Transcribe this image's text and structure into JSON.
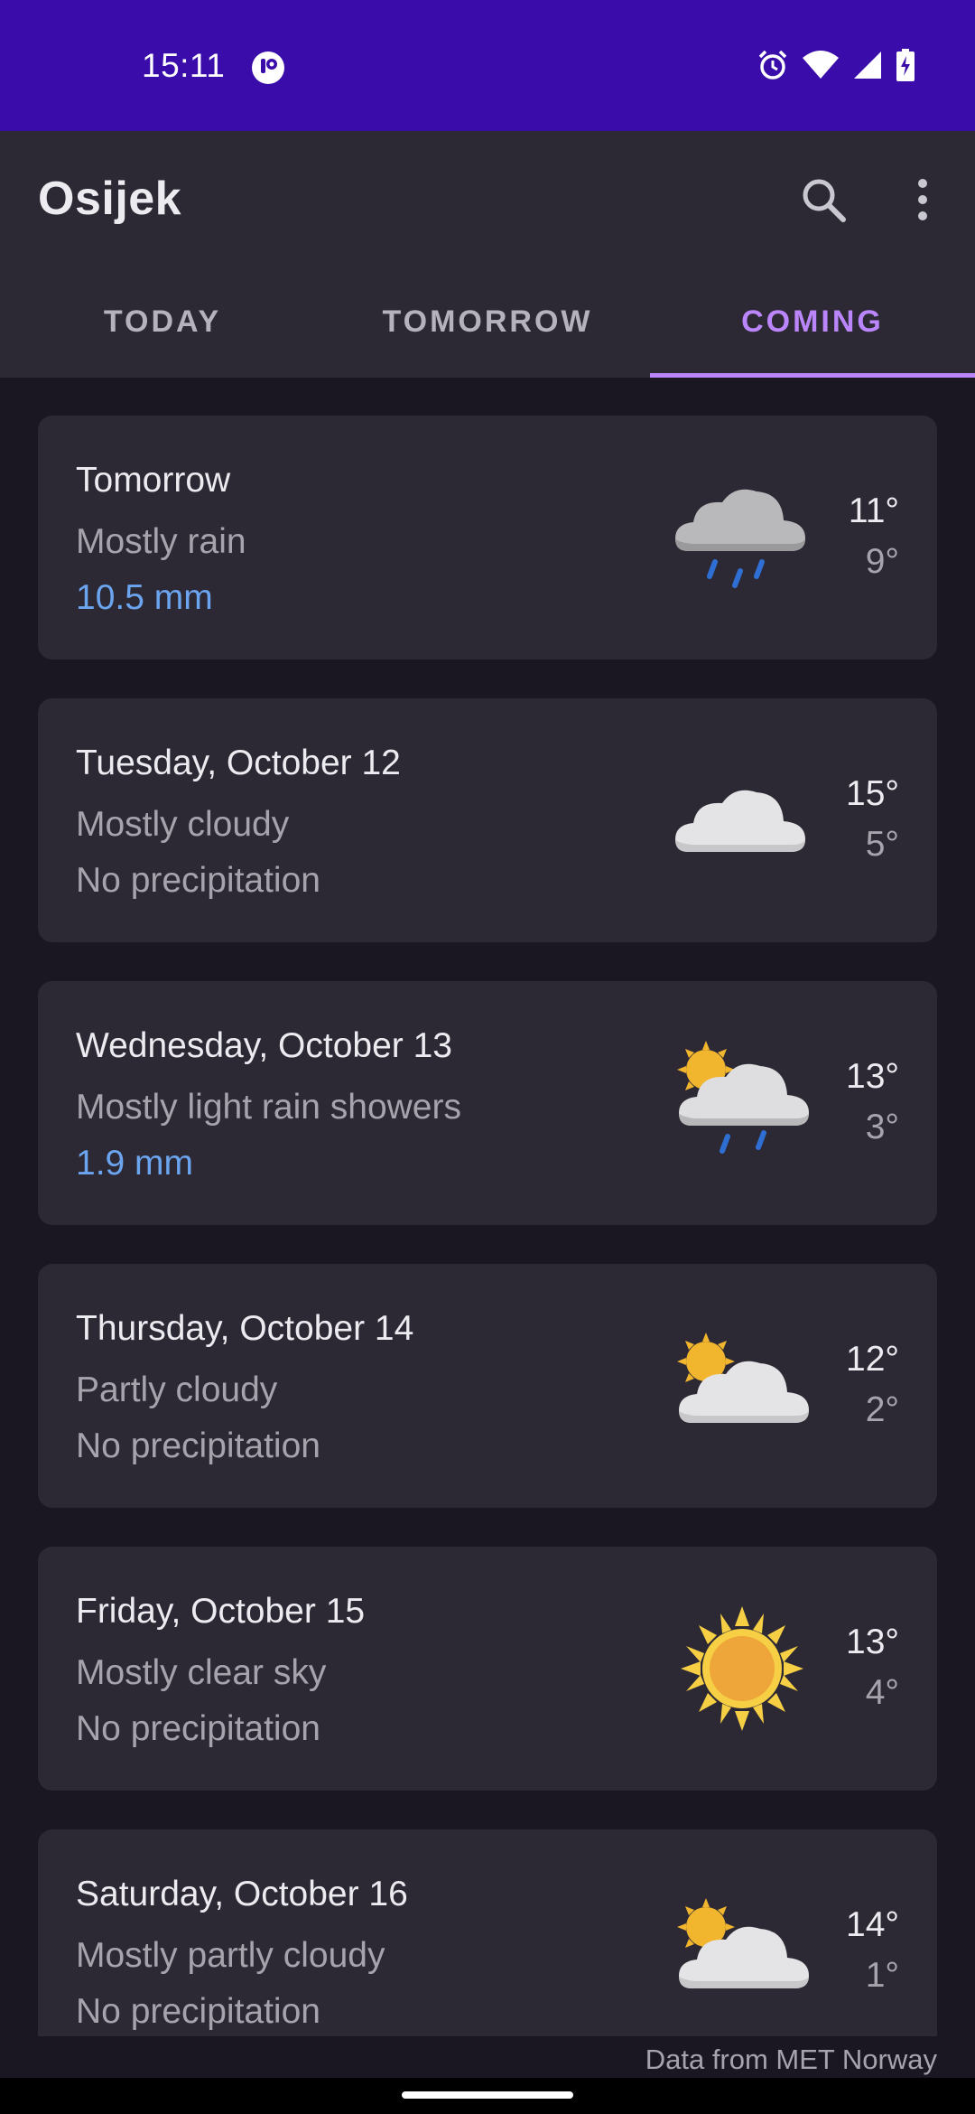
{
  "status_bar": {
    "time": "15:11",
    "icons": [
      "app-notification-icon",
      "alarm-icon",
      "wifi-icon",
      "signal-icon",
      "battery-charging-icon"
    ]
  },
  "app_bar": {
    "title": "Osijek",
    "actions": [
      "search-icon",
      "more-vert-icon"
    ]
  },
  "tabs": [
    {
      "label": "TODAY",
      "active": false
    },
    {
      "label": "TOMORROW",
      "active": false
    },
    {
      "label": "COMING",
      "active": true
    }
  ],
  "forecast": [
    {
      "day": "Tomorrow",
      "desc": "Mostly rain",
      "precip": "10.5 mm",
      "high": "11°",
      "low": "9°",
      "icon": "rain-cloud-icon"
    },
    {
      "day": "Tuesday, October 12",
      "desc": "Mostly cloudy",
      "precip": "No precipitation",
      "high": "15°",
      "low": "5°",
      "icon": "cloud-icon"
    },
    {
      "day": "Wednesday, October 13",
      "desc": "Mostly light rain showers",
      "precip": "1.9 mm",
      "high": "13°",
      "low": "3°",
      "icon": "sun-cloud-rain-icon"
    },
    {
      "day": "Thursday, October 14",
      "desc": "Partly cloudy",
      "precip": "No precipitation",
      "high": "12°",
      "low": "2°",
      "icon": "sun-cloud-icon"
    },
    {
      "day": "Friday, October 15",
      "desc": "Mostly clear sky",
      "precip": "No precipitation",
      "high": "13°",
      "low": "4°",
      "icon": "sun-icon"
    },
    {
      "day": "Saturday, October 16",
      "desc": "Mostly partly cloudy",
      "precip": "No precipitation",
      "high": "14°",
      "low": "1°",
      "icon": "sun-cloud-icon"
    }
  ],
  "attribution": "Data from MET Norway",
  "colors": {
    "status_bar": "#3a0caa",
    "app_bar": "#2c2934",
    "background": "#1a1622",
    "accent": "#bb86fc",
    "rain_text": "#6ba4ef"
  }
}
